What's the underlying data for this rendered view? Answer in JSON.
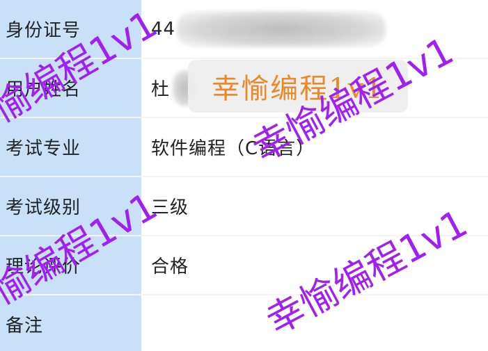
{
  "rows": [
    {
      "label": "身份证号",
      "value": "44"
    },
    {
      "label": "用户姓名",
      "value": "杜"
    },
    {
      "label": "考试专业",
      "value": "软件编程（C语言）"
    },
    {
      "label": "考试级别",
      "value": "三级"
    },
    {
      "label": "理论评价",
      "value": "合格"
    },
    {
      "label": "备注",
      "value": ""
    }
  ],
  "overlay_watermark": "幸愉编程1v1",
  "watermarks": [
    "幸愉编程1v1",
    "幸愉编程1v1",
    "幸愉编程1v1",
    "幸愉编程1v1"
  ],
  "colors": {
    "label_background": "#c8e0f8",
    "watermark": "#a020f0",
    "overlay_text": "#e98a2a"
  }
}
